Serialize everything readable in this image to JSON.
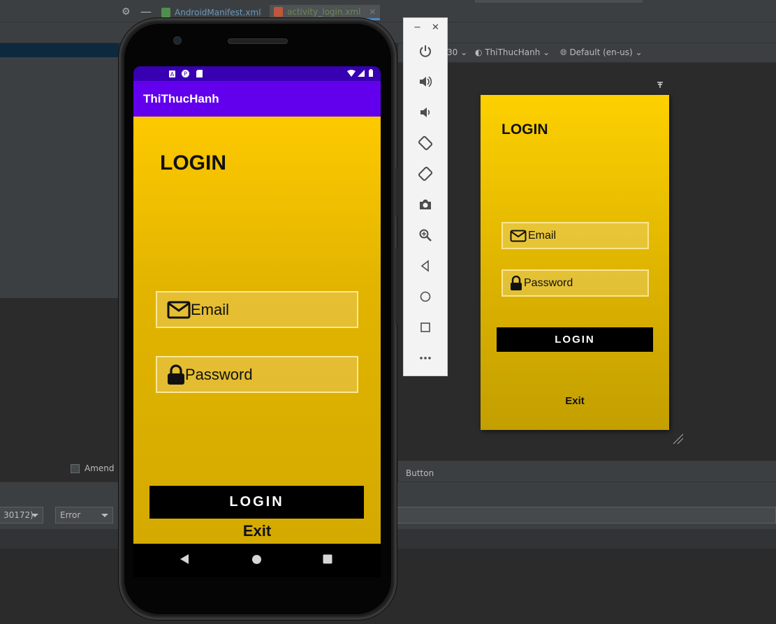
{
  "ide": {
    "tabs": [
      {
        "label": "AndroidManifest.xml"
      },
      {
        "label": "activity_login.xml"
      }
    ],
    "design_toolbar": {
      "api_level": "30",
      "theme": "ThiThucHanh",
      "locale": "Default (en-us)"
    },
    "amend_label": "Amend",
    "component_label": "Button",
    "logcat": {
      "process_value": "30172)",
      "level_value": "Error"
    }
  },
  "preview": {
    "title": "LOGIN",
    "email_hint": "Email",
    "password_hint": "Password",
    "login_button": "LOGIN",
    "exit_label": "Exit"
  },
  "emulator": {
    "app_title": "ThiThucHanh",
    "login_title": "LOGIN",
    "email_hint": "Email",
    "password_hint": "Password",
    "login_button": "LOGIN",
    "exit_label": "Exit",
    "toolbar_icons": [
      "power-icon",
      "volume-up-icon",
      "volume-down-icon",
      "rotate-left-icon",
      "rotate-right-icon",
      "camera-icon",
      "zoom-icon",
      "back-icon",
      "home-icon",
      "overview-icon",
      "more-icon"
    ]
  },
  "colors": {
    "status_bar": "#3700b3",
    "app_bar": "#6200ee",
    "content_gradient_top": "#fdc900",
    "content_gradient_bottom": "#d4aa00",
    "button_bg": "#000000"
  }
}
